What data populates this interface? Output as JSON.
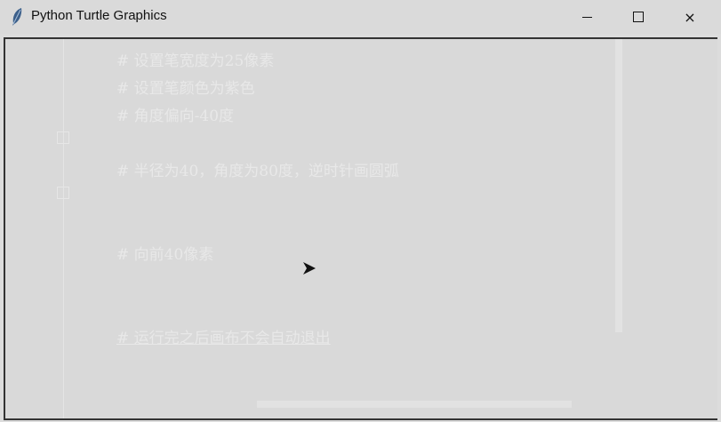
{
  "window": {
    "title": "Python Turtle Graphics",
    "controls": {
      "minimize": "minimize",
      "maximize": "maximize",
      "close": "×"
    }
  },
  "background_code": [
    "#  设置笔宽度为25像素",
    "#  设置笔颜色为紫色",
    "#  角度偏向-40度",
    "#  半径为40，角度为80度，逆时针画圆弧",
    "#  向前40像素",
    "#  运行完之后画布不会自动退出"
  ],
  "icons": {
    "app": "feather-icon",
    "turtle": "turtle-cursor-icon"
  },
  "colors": {
    "canvas": "#d9d9d9",
    "titlebar": "#dadada",
    "turtle": "#111111"
  }
}
